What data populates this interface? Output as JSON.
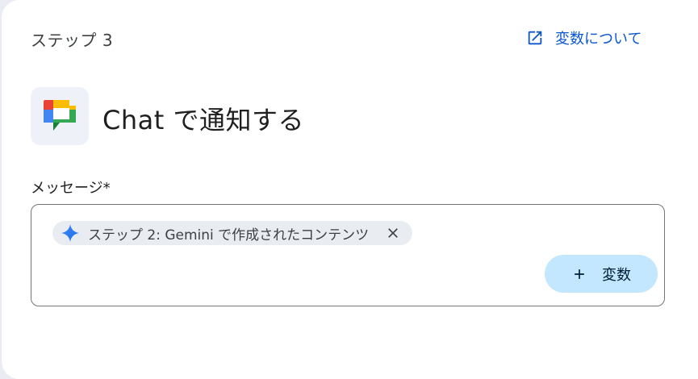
{
  "header": {
    "step_label": "ステップ 3",
    "variables_link": "変数について",
    "variables_link_icon": "open-in-new-icon"
  },
  "app": {
    "icon": "google-chat-icon",
    "title": "Chat で通知する"
  },
  "message": {
    "label": "メッセージ*",
    "chip": {
      "icon": "gemini-sparkle-icon",
      "text": "ステップ 2: Gemini で作成されたコンテンツ",
      "close_icon": "close-icon"
    },
    "add_variable_button": "変数",
    "add_variable_icon": "plus-icon"
  },
  "colors": {
    "link": "#0b57d0",
    "button_bg": "#c2e7ff",
    "chip_bg": "#e9edf2",
    "border": "#747775"
  }
}
